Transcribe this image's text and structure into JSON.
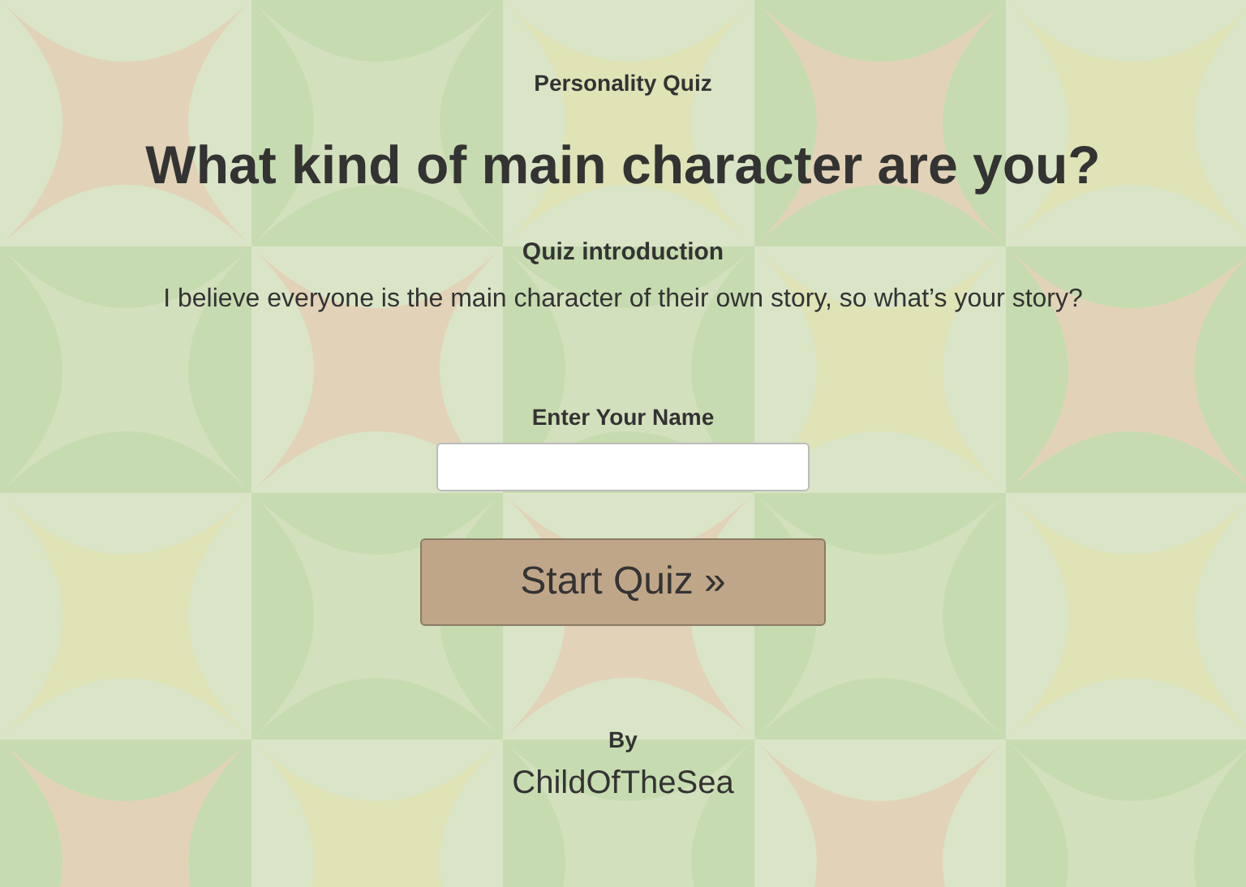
{
  "quiz_type": "Personality Quiz",
  "title": "What kind of main character are you?",
  "intro_heading": "Quiz introduction",
  "intro_text": "I believe everyone is the main character of their own story, so what’s your story?",
  "name_field": {
    "label": "Enter Your Name"
  },
  "start_button": {
    "label": "Start Quiz »"
  },
  "author": {
    "by_label": "By",
    "name": "ChildOfTheSea"
  }
}
